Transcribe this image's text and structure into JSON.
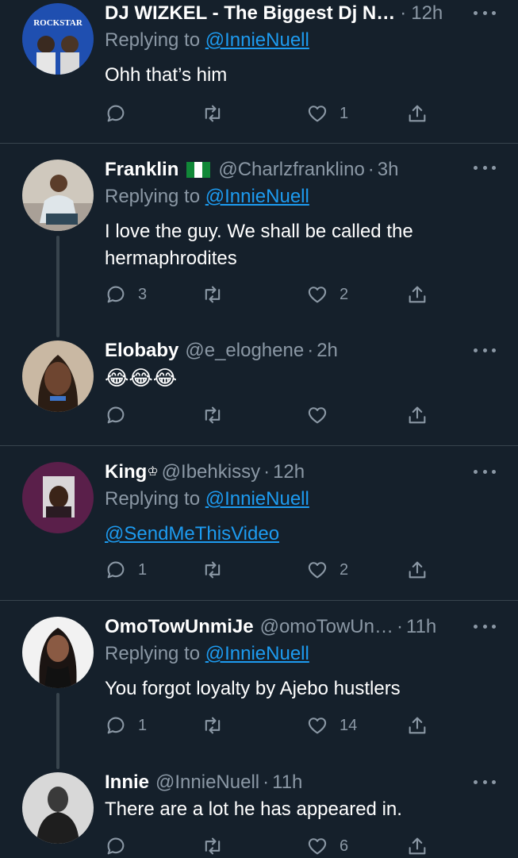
{
  "tweets": [
    {
      "name": "DJ WIZKEL - The Biggest Dj N…",
      "avatar_text": "ROCKSTAR",
      "handle": "",
      "time": "12h",
      "replying_prefix": "Replying to ",
      "replying_to": "@InnieNuell",
      "text": "Ohh that’s him",
      "replies": "",
      "likes": "1"
    },
    {
      "name": "Franklin",
      "handle": "@Charlzfranklino",
      "time": "3h",
      "replying_prefix": "Replying to ",
      "replying_to": "@InnieNuell",
      "text_line1": "I love the guy. We shall be called the",
      "text_line2": "hermaphrodites",
      "replies": "3",
      "likes": "2"
    },
    {
      "name": "Elobaby",
      "handle": "@e_eloghene",
      "time": "2h",
      "text": "😂😂😂",
      "replies": "",
      "likes": ""
    },
    {
      "name": "King",
      "name_suffix": "♔",
      "handle": "@Ibehkissy",
      "time": "12h",
      "replying_prefix": "Replying to ",
      "replying_to": "@InnieNuell",
      "text_link": "@SendMeThisVideo",
      "replies": "1",
      "likes": "2"
    },
    {
      "name": "OmoTowUnmiJe",
      "handle": "@omoTowUn…",
      "time": "11h",
      "replying_prefix": "Replying to ",
      "replying_to": "@InnieNuell",
      "text": "You forgot loyalty by Ajebo hustlers",
      "replies": "1",
      "likes": "14"
    },
    {
      "name": "Innie",
      "handle": "@InnieNuell",
      "time": "11h",
      "text": "There are a lot he has appeared in.",
      "replies": "",
      "likes": "6"
    }
  ],
  "separator": "·",
  "icons": {
    "reply": "reply-icon",
    "retweet": "retweet-icon",
    "like": "heart-icon",
    "share": "share-icon",
    "more": "more-icon"
  },
  "colors": {
    "background": "#15202b",
    "secondary_text": "#8b98a5",
    "link": "#1d9bf0",
    "divider": "#38444d"
  }
}
